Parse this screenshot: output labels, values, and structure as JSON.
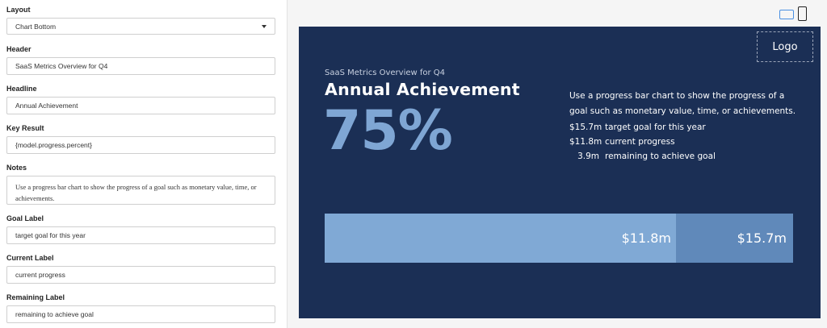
{
  "form": {
    "layout": {
      "label": "Layout",
      "value": "Chart Bottom"
    },
    "header": {
      "label": "Header",
      "value": "SaaS Metrics Overview for Q4"
    },
    "headline": {
      "label": "Headline",
      "value": "Annual Achievement"
    },
    "key_result": {
      "label": "Key Result",
      "value": "{model.progress.percent}"
    },
    "notes": {
      "label": "Notes",
      "value": "Use a progress bar chart to show the progress of a goal such as monetary value, time, or achievements."
    },
    "goal_label": {
      "label": "Goal Label",
      "value": "target goal for this year"
    },
    "current_label": {
      "label": "Current Label",
      "value": "current progress"
    },
    "remaining_label": {
      "label": "Remaining Label",
      "value": "remaining to achieve goal"
    }
  },
  "preview": {
    "device_icons": [
      "tablet-icon",
      "phone-icon"
    ],
    "logo": "Logo",
    "header": "SaaS Metrics Overview for Q4",
    "headline": "Annual Achievement",
    "key_result": "75%",
    "notes": "Use a progress bar chart to show the progress of a goal such as monetary value, time, or achievements.",
    "legend": [
      {
        "value": "$15.7m",
        "text": "target goal for this year"
      },
      {
        "value": "$11.8m",
        "text": "current progress"
      },
      {
        "value": "3.9m",
        "text": "remaining to achieve goal"
      }
    ],
    "progress": {
      "fraction": 0.75,
      "current_label": "$11.8m",
      "goal_label": "$15.7m"
    }
  },
  "colors": {
    "slide_bg": "#1b2f55",
    "kpi": "#7fa6d4",
    "bar_fill": "#80a9d5",
    "bar_track": "#6089ba",
    "accent": "#4a90e2"
  }
}
